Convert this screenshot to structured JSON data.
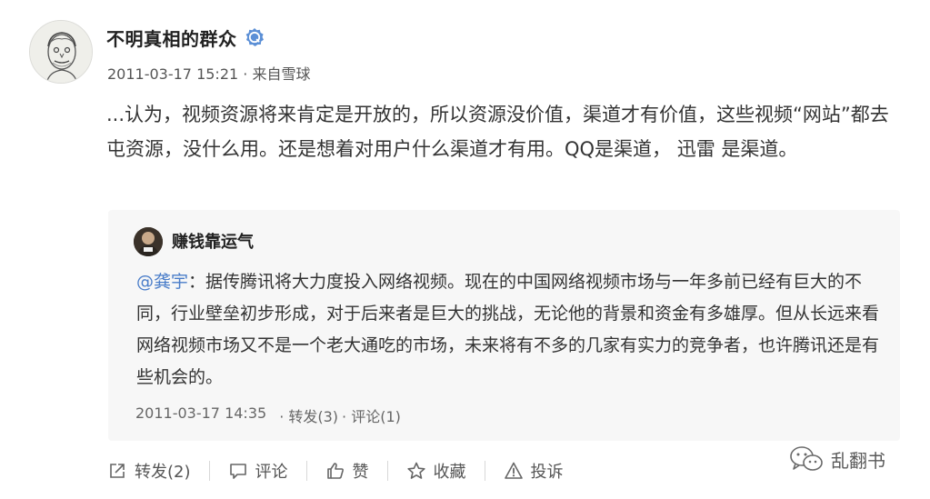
{
  "post": {
    "author": "不明真相的群众",
    "timestamp": "2011-03-17 15:21",
    "source": "· 来自雪球",
    "text": "...认为，视频资源将来肯定是开放的，所以资源没价值，渠道才有价值，这些视频“网站”都去屯资源，没什么用。还是想着对用户什么渠道才有用。QQ是渠道， 迅雷 是渠道。"
  },
  "repost": {
    "author": "赚钱靠运气",
    "mention": "@龚宇",
    "body": "：据传腾讯将大力度投入网络视频。现在的中国网络视频市场与一年多前已经有巨大的不同，行业壁垒初步形成，对于后来者是巨大的挑战，无论他的背景和资金有多雄厚。但从长远来看网络视频市场又不是一个老大通吃的市场，未来将有不多的几家有实力的竞争者，也许腾讯还是有些机会的。",
    "timestamp": "2011-03-17 14:35",
    "forward_label": "· 转发(3)",
    "comment_label": "· 评论(1)"
  },
  "actions": {
    "forward": "转发(2)",
    "comment": "评论",
    "like": "赞",
    "favorite": "收藏",
    "report": "投诉"
  },
  "watermark": "乱翻书",
  "icons": {
    "verified": "verified-badge-icon",
    "forward": "share-icon",
    "comment": "comment-icon",
    "like": "thumbs-up-icon",
    "favorite": "star-icon",
    "report": "warning-icon",
    "watermark": "wechat-icon"
  },
  "colors": {
    "mention": "#4a7dc9",
    "verified_badge": "#5b8fd6",
    "repost_bg": "#f7f7f7"
  }
}
